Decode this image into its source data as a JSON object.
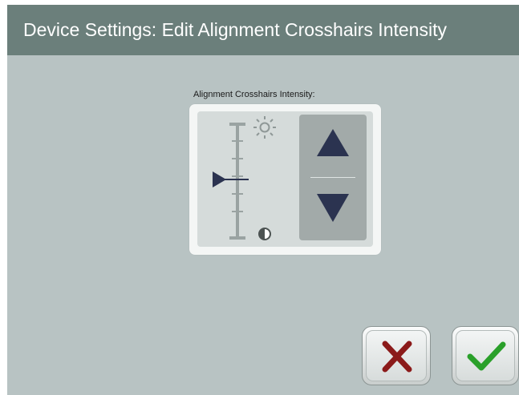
{
  "header": {
    "title": "Device Settings: Edit Alignment Crosshairs Intensity"
  },
  "intensity": {
    "label": "Alignment Crosshairs Intensity:",
    "level": 0.5,
    "max_icon": "sun-icon",
    "min_icon": "contrast-icon"
  },
  "controls": {
    "increase_icon": "arrow-up-icon",
    "decrease_icon": "arrow-down-icon"
  },
  "actions": {
    "cancel_icon": "x-icon",
    "confirm_icon": "checkmark-icon"
  },
  "colors": {
    "header_bg": "#6b7f7b",
    "screen_bg": "#b8c3c3",
    "arrow": "#2b3350",
    "cancel": "#8b1a1a",
    "confirm": "#2aa02a"
  }
}
